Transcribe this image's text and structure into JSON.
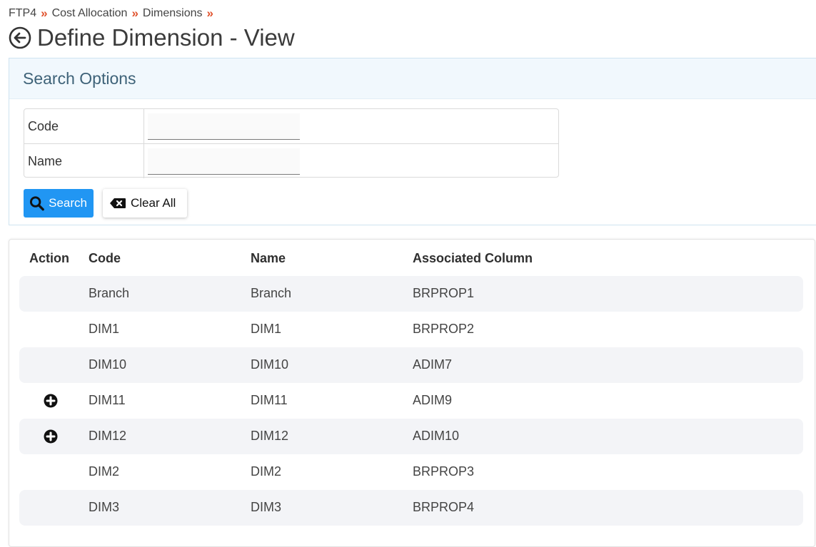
{
  "breadcrumb": {
    "items": [
      "FTP4",
      "Cost Allocation",
      "Dimensions"
    ],
    "separator": "»"
  },
  "page": {
    "title": "Define Dimension - View"
  },
  "search": {
    "header": "Search Options",
    "code_label": "Code",
    "code_value": "",
    "name_label": "Name",
    "name_value": "",
    "search_button": "Search",
    "clear_button": "Clear All"
  },
  "grid": {
    "headers": {
      "action": "Action",
      "code": "Code",
      "name": "Name",
      "assoc": "Associated Column"
    },
    "rows": [
      {
        "code": "Branch",
        "name": "Branch",
        "assoc": "BRPROP1",
        "action_icon": ""
      },
      {
        "code": "DIM1",
        "name": "DIM1",
        "assoc": "BRPROP2",
        "action_icon": ""
      },
      {
        "code": "DIM10",
        "name": "DIM10",
        "assoc": "ADIM7",
        "action_icon": ""
      },
      {
        "code": "DIM11",
        "name": "DIM11",
        "assoc": "ADIM9",
        "action_icon": "plus-circle-icon"
      },
      {
        "code": "DIM12",
        "name": "DIM12",
        "assoc": "ADIM10",
        "action_icon": "plus-circle-icon"
      },
      {
        "code": "DIM2",
        "name": "DIM2",
        "assoc": "BRPROP3",
        "action_icon": ""
      },
      {
        "code": "DIM3",
        "name": "DIM3",
        "assoc": "BRPROP4",
        "action_icon": ""
      }
    ]
  },
  "colors": {
    "accent": "#2196f3",
    "breadcrumb_separator": "#e0522d",
    "row_alt": "#f3f4f7"
  }
}
